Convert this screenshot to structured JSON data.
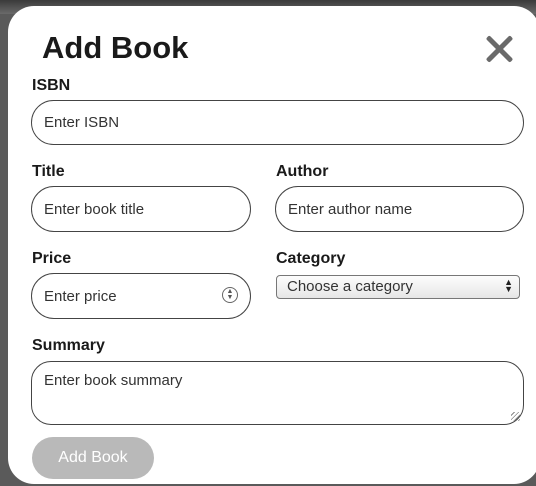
{
  "modal": {
    "title": "Add Book",
    "close_icon": "close-icon",
    "fields": {
      "isbn": {
        "label": "ISBN",
        "placeholder": "Enter ISBN",
        "value": ""
      },
      "title": {
        "label": "Title",
        "placeholder": "Enter book title",
        "value": ""
      },
      "author": {
        "label": "Author",
        "placeholder": "Enter author name",
        "value": ""
      },
      "price": {
        "label": "Price",
        "placeholder": "Enter price",
        "value": ""
      },
      "category": {
        "label": "Category",
        "selected": "Choose a category"
      },
      "summary": {
        "label": "Summary",
        "placeholder": "Enter book summary",
        "value": ""
      }
    },
    "submit_label": "Add Book"
  },
  "colors": {
    "modal_bg": "#ffffff",
    "backdrop": "#5a5a5a",
    "submit_bg": "#b9b9b9",
    "border": "#444444"
  }
}
